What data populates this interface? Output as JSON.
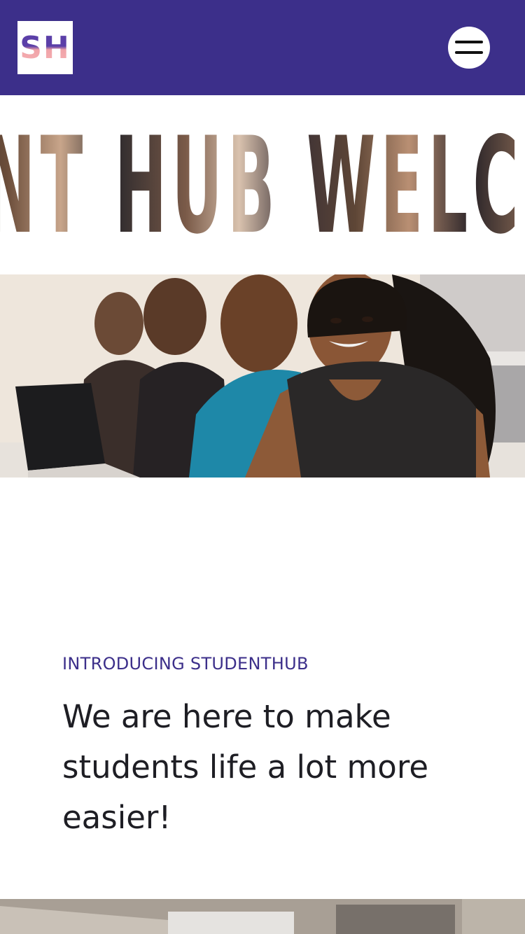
{
  "header": {
    "logo_text": "SH",
    "menu_icon": "hamburger-menu-icon",
    "background_color": "#3c2f8a"
  },
  "banner": {
    "text": "ENT HUB WELCOME TO"
  },
  "hero": {
    "image": "students-in-classroom-photo"
  },
  "intro": {
    "eyebrow": "INTRODUCING STUDENTHUB",
    "heading": "We are here to make students life a lot more easier!"
  },
  "bottom": {
    "image": "classroom-photo"
  },
  "colors": {
    "accent": "#3c2f8a",
    "text": "#1e1e24"
  }
}
